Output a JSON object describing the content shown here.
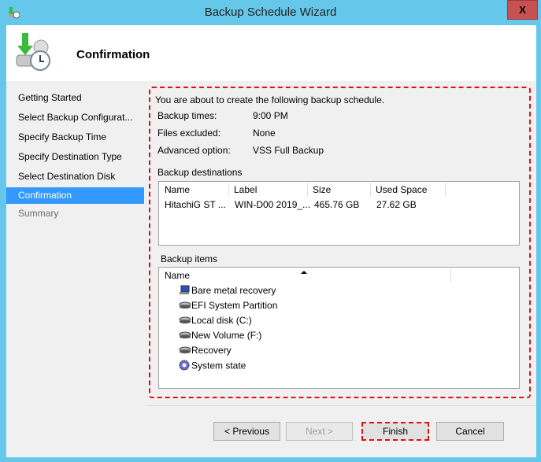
{
  "window": {
    "title": "Backup Schedule Wizard",
    "close_label": "X"
  },
  "header": {
    "title": "Confirmation"
  },
  "nav": {
    "items": [
      {
        "label": "Getting Started",
        "state": "normal"
      },
      {
        "label": "Select Backup Configurat...",
        "state": "normal"
      },
      {
        "label": "Specify Backup Time",
        "state": "normal"
      },
      {
        "label": "Specify Destination Type",
        "state": "normal"
      },
      {
        "label": "Select Destination Disk",
        "state": "normal"
      },
      {
        "label": "Confirmation",
        "state": "selected"
      },
      {
        "label": "Summary",
        "state": "disabled"
      }
    ]
  },
  "main": {
    "intro": "You are about to create the following backup schedule.",
    "details": [
      {
        "label": "Backup times:",
        "value": "9:00 PM"
      },
      {
        "label": "Files excluded:",
        "value": "None"
      },
      {
        "label": "Advanced option:",
        "value": "VSS Full Backup"
      }
    ],
    "destinations": {
      "title": "Backup destinations",
      "columns": [
        "Name",
        "Label",
        "Size",
        "Used Space"
      ],
      "rows": [
        [
          "HitachiG ST ...",
          "WIN-D00 2019_...",
          "465.76 GB",
          "27.62 GB"
        ]
      ]
    },
    "items": {
      "title": "Backup items",
      "column": "Name",
      "rows": [
        {
          "label": "Bare metal recovery",
          "icon": "computer-icon"
        },
        {
          "label": "EFI System Partition",
          "icon": "disk-icon"
        },
        {
          "label": "Local disk (C:)",
          "icon": "disk-icon"
        },
        {
          "label": "New Volume (F:)",
          "icon": "disk-icon"
        },
        {
          "label": "Recovery",
          "icon": "disk-icon"
        },
        {
          "label": "System state",
          "icon": "gear-icon"
        }
      ]
    }
  },
  "buttons": {
    "previous": "< Previous",
    "next": "Next >",
    "finish": "Finish",
    "cancel": "Cancel"
  },
  "colors": {
    "titlebar": "#65c8ea",
    "selected": "#3399ff",
    "highlight": "#e01010"
  }
}
